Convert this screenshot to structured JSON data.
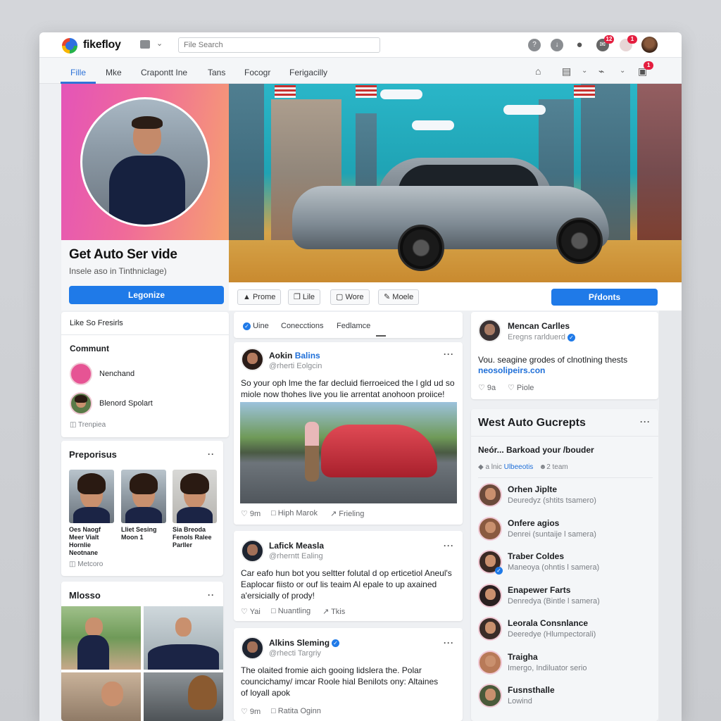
{
  "topbar": {
    "brand": "fikefloy",
    "search_placeholder": "File Search",
    "icons": [
      "help-icon",
      "download-icon",
      "people-icon",
      "messages-icon",
      "notifications-icon",
      "profile-avatar"
    ],
    "badges": {
      "messages": "12",
      "notifications": "1"
    }
  },
  "nav": {
    "tabs": [
      {
        "label": "Fille",
        "active": true
      },
      {
        "label": "Mke",
        "active": false
      },
      {
        "label": "Crapontt Ine",
        "active": false
      },
      {
        "label": "Tans",
        "active": false
      },
      {
        "label": "Focogr",
        "active": false
      },
      {
        "label": "Ferigacilly",
        "active": false
      }
    ],
    "right_icons": [
      "home-icon",
      "document-icon",
      "marketplace-icon",
      "inbox-icon"
    ],
    "inbox_badge": "1",
    "accent": "#2f74d8"
  },
  "profile": {
    "title": "Get Auto Ser vide",
    "subtitle": "Insele aso in Tinthniclage)",
    "button": "Legonize"
  },
  "hero": {
    "actions": [
      {
        "icon": "triangle-icon",
        "label": "Prome"
      },
      {
        "icon": "copy-icon",
        "label": "Lile"
      },
      {
        "icon": "edit-box-icon",
        "label": "Wore"
      },
      {
        "icon": "pencil-icon",
        "label": "Moele"
      }
    ],
    "primary_button": "Pŕdonts"
  },
  "left": {
    "like_label": "Like So Fresirls",
    "community": {
      "title": "Communt",
      "members": [
        {
          "name": "Nenchand"
        },
        {
          "name": "Blenord Spolart"
        }
      ],
      "footer": "Trenpiea"
    },
    "photos_card": {
      "title": "Preporisus",
      "items": [
        {
          "caption": "Oes Naogf Meer Vialt Hornlie Neotnane"
        },
        {
          "caption": "Lliet Sesing Moon 1"
        },
        {
          "caption": "Sia Breoda Fenols Ralee Parller"
        }
      ],
      "footer": "Metcoro"
    },
    "gallery": {
      "title": "Mlosso"
    }
  },
  "feed": {
    "tabs": [
      {
        "label": "Uine",
        "checked": true
      },
      {
        "label": "Conecctions",
        "checked": false
      },
      {
        "label": "Fedlamce",
        "checked": false
      }
    ],
    "posts": [
      {
        "name_first": "Aokin",
        "name_second": "Balins",
        "handle": "@rherti Eolgcin",
        "text": "So your oph lme the far decluid fierroeiced the l gld ud so miole now thohes live you lie arrentat anohoon proiice!",
        "actions": [
          "9m",
          "Hiph Marok",
          "Frieling"
        ],
        "has_image": true
      },
      {
        "name": "Lafick Measla",
        "handle": "@rherntt Ealing",
        "text": "Car eafo hun bot you seltter folutal d op erticetiol Aneul's Eaplocar fiisto or ouf lis teaim Al epale to up axained a'ersicially of prody!",
        "actions": [
          "Yai",
          "Nuantling",
          "Tkis"
        ]
      },
      {
        "name": "Alkins Sleming",
        "verified": true,
        "handle": "@rhecti Targriy",
        "text": "The olaited fromie aich gooing lidslera the. Polar councichamy/ imcar Roole hial Benilots ony: Altaines of loyall apok",
        "actions": [
          "9m",
          "Ratita Oginn"
        ]
      }
    ]
  },
  "right": {
    "profile_post": {
      "name": "Mencan Carlles",
      "handle": "Eregns rarlduerd",
      "verified": true,
      "text": "Vou. seagine grodes of clnotlning thests",
      "link": "neosolipeirs.con",
      "actions": [
        "9a",
        "Piole"
      ]
    },
    "group": {
      "title": "West Auto Gucrepts",
      "prompt": "Neór... Barkoad your /bouder",
      "meta_left": "a lnic",
      "meta_link": "Ulbeeotis",
      "meta_right": "2 team",
      "members": [
        {
          "name": "Orhen Jiplte",
          "role": "Deuredyz (shtits tsamero)"
        },
        {
          "name": "Onfere agios",
          "role": "Denrei (suntaije l samera)"
        },
        {
          "name": "Traber Coldes",
          "role": "Maneoya (ohntis l samera)",
          "verified": true
        },
        {
          "name": "Enapewer Farts",
          "role": "Denredya (Bintle l samera)"
        },
        {
          "name": "Leorala Consnlance",
          "role": "Deeredye (Hlumpectorali)"
        },
        {
          "name": "Traigha",
          "role": "Imergo, Indiluator serio"
        },
        {
          "name": "Fusnsthalle",
          "role": "Lowind"
        }
      ]
    }
  },
  "colors": {
    "primary": "#1f7ae8",
    "link": "#1f6fd8",
    "badge": "#e41e3f"
  }
}
